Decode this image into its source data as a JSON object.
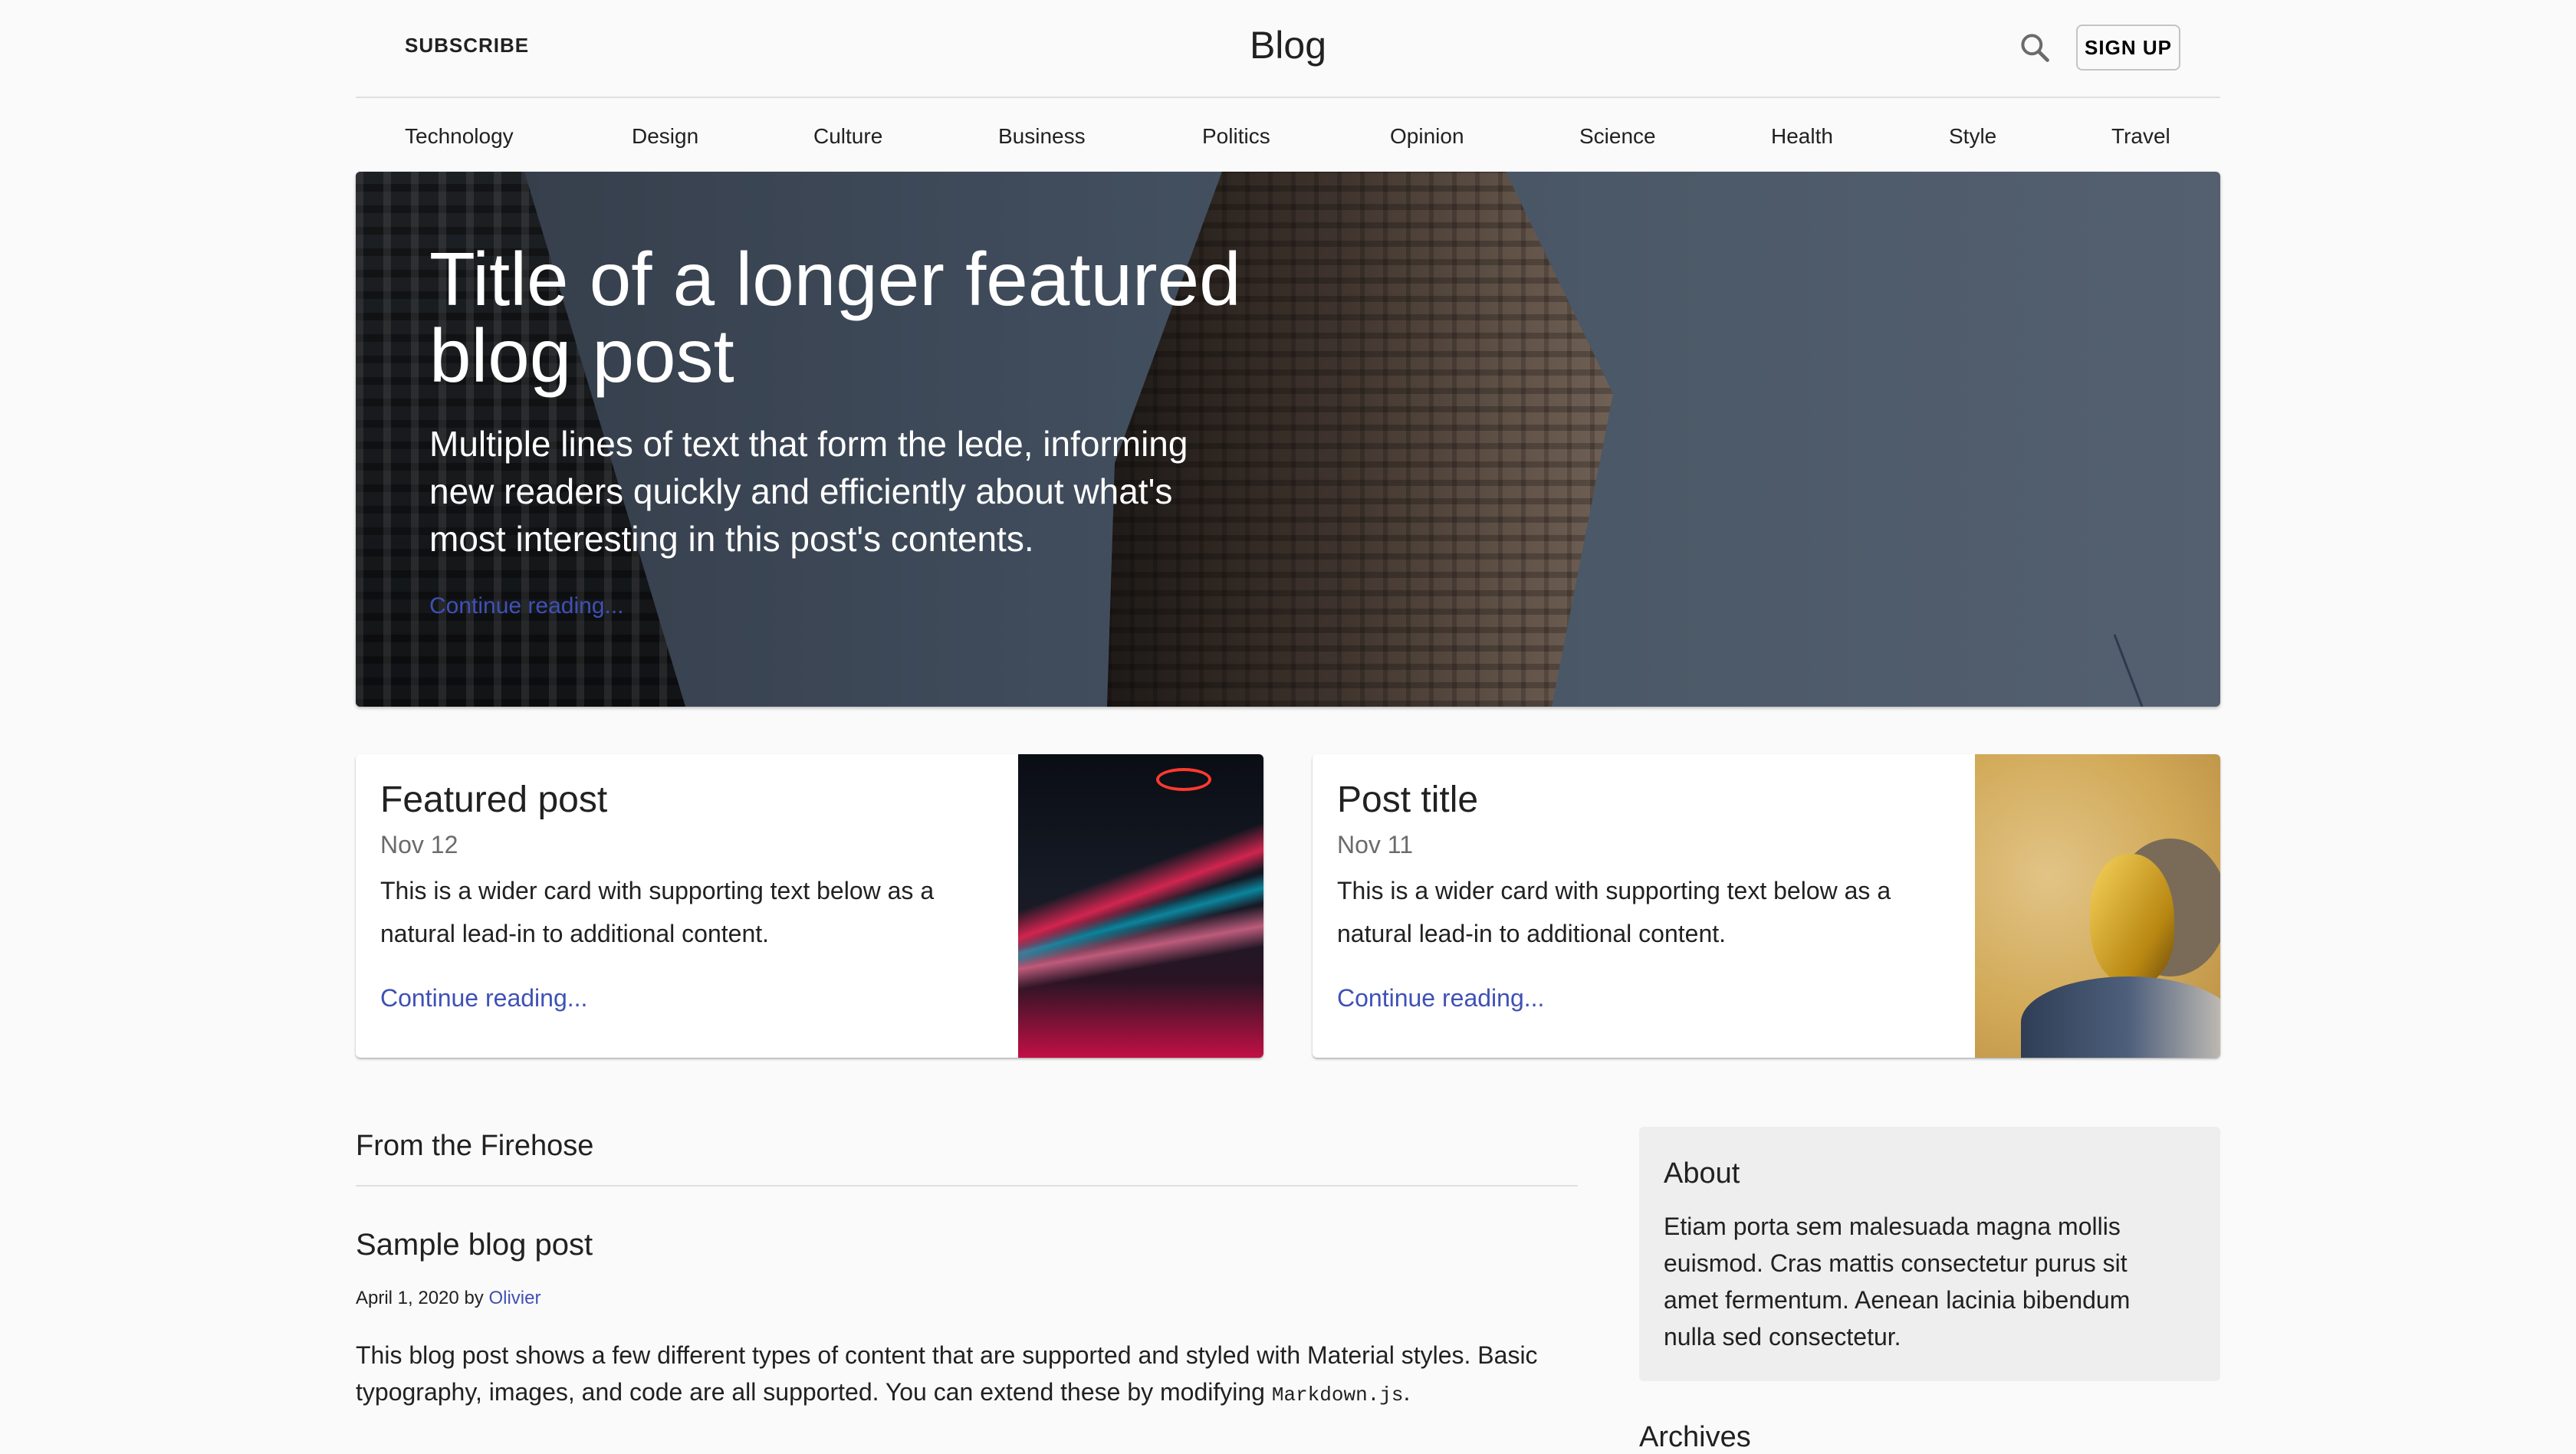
{
  "header": {
    "subscribe": "SUBSCRIBE",
    "title": "Blog",
    "signup": "SIGN UP",
    "search_icon": "search-icon"
  },
  "nav": [
    "Technology",
    "Design",
    "Culture",
    "Business",
    "Politics",
    "Opinion",
    "Science",
    "Health",
    "Style",
    "Travel"
  ],
  "hero": {
    "title": "Title of a longer featured blog post",
    "lede": "Multiple lines of text that form the lede, informing new readers quickly and efficiently about what's most interesting in this post's contents.",
    "link": "Continue reading..."
  },
  "cards": [
    {
      "title": "Featured post",
      "date": "Nov 12",
      "text": "This is a wider card with supporting text below as a natural lead-in to additional content.",
      "link": "Continue reading..."
    },
    {
      "title": "Post title",
      "date": "Nov 11",
      "text": "This is a wider card with supporting text below as a natural lead-in to additional content.",
      "link": "Continue reading..."
    }
  ],
  "firehose": {
    "title": "From the Firehose",
    "post": {
      "title": "Sample blog post",
      "date": "April 1, 2020",
      "by": "by",
      "author": "Olivier",
      "body_prefix": "This blog post shows a few different types of content that are supported and styled with Material styles. Basic typography, images, and code are all supported. You can extend these by modifying",
      "body_code": "Markdown.js",
      "body_suffix": "."
    }
  },
  "sidebar": {
    "about_title": "About",
    "about_text": "Etiam porta sem malesuada magna mollis euismod. Cras mattis consectetur purus sit amet fermentum. Aenean lacinia bibendum nulla sed consectetur.",
    "archives_title": "Archives"
  },
  "colors": {
    "accent": "#3f51b5",
    "background": "#fafafa",
    "text": "#212121"
  }
}
